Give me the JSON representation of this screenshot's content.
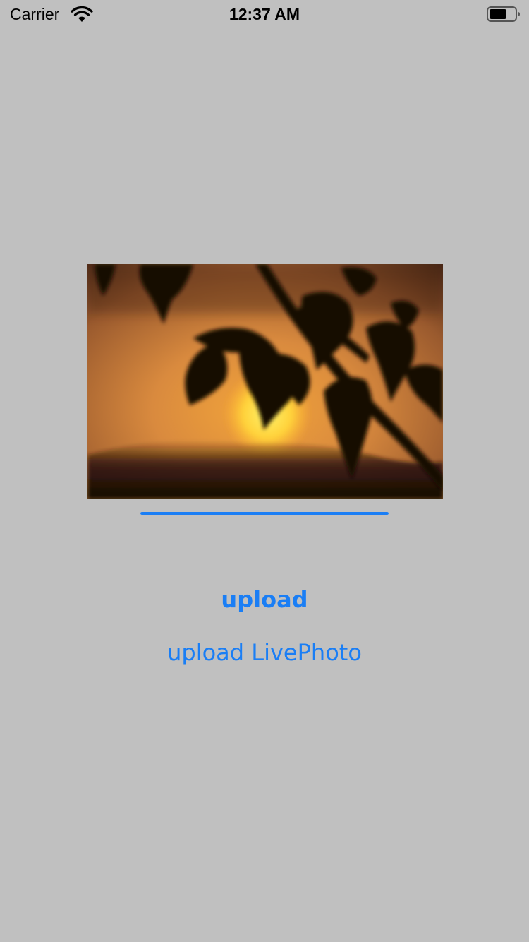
{
  "status_bar": {
    "carrier": "Carrier",
    "time": "12:37 AM",
    "wifi_icon": "wifi-icon",
    "battery_icon": "battery-icon"
  },
  "photo": {
    "icon": "sunset-leaves-photo"
  },
  "progress": {
    "value": 1.0,
    "color": "#1a7ef5"
  },
  "buttons": {
    "upload_label": "upload",
    "upload_livephoto_label": "upload LivePhoto"
  },
  "colors": {
    "background": "#c0c0c0",
    "accent": "#1a7ef5"
  }
}
